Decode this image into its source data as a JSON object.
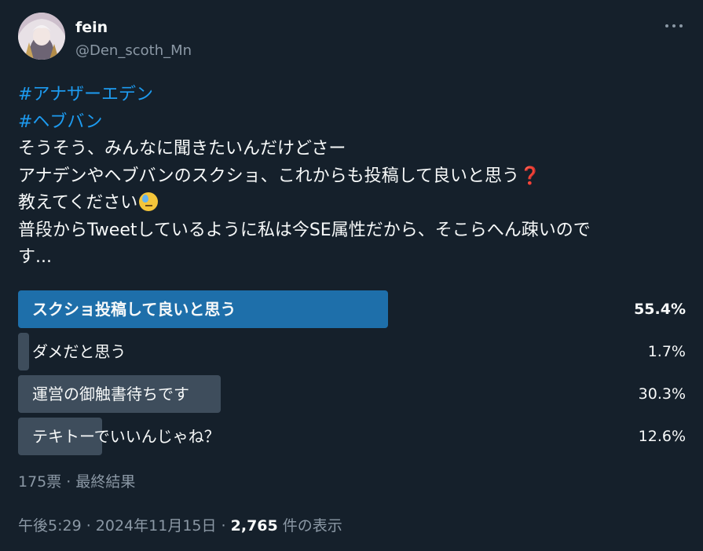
{
  "author": {
    "name": "fein",
    "handle": "@Den_scoth_Mn"
  },
  "tweet": {
    "hashtags": [
      "#アナザーエデン",
      "#ヘブバン"
    ],
    "lines": [
      "そうそう、みんなに聞きたいんだけどさー",
      "アナデンやヘブバンのスクショ、これからも投稿して良いと思う",
      "教えてください",
      "普段からTweetしているように私は今SE属性だから、そこらへん疎いので",
      "す..."
    ],
    "emoji_question": "❓"
  },
  "poll": {
    "options": [
      {
        "label": "スクショ投稿して良いと思う",
        "percent_text": "55.4%",
        "fraction": 0.554,
        "winner": true
      },
      {
        "label": "ダメだと思う",
        "percent_text": "1.7%",
        "fraction": 0.017,
        "winner": false
      },
      {
        "label": "運営の御触書待ちです",
        "percent_text": "30.3%",
        "fraction": 0.303,
        "winner": false
      },
      {
        "label": "テキトーでいいんじゃね？",
        "percent_text": "12.6%",
        "fraction": 0.126,
        "winner": false
      }
    ],
    "summary": "175票 · 最終結果"
  },
  "meta": {
    "datetime": "午後5:29 · 2024年11月15日 · ",
    "views_count": "2,765",
    "views_label": " 件の表示"
  },
  "colors": {
    "background": "#15202b",
    "hashtag": "#1d9bf0",
    "winner_bar": "#1e6faa",
    "bar": "#3e4d5c",
    "muted_text": "#8b98a5"
  }
}
